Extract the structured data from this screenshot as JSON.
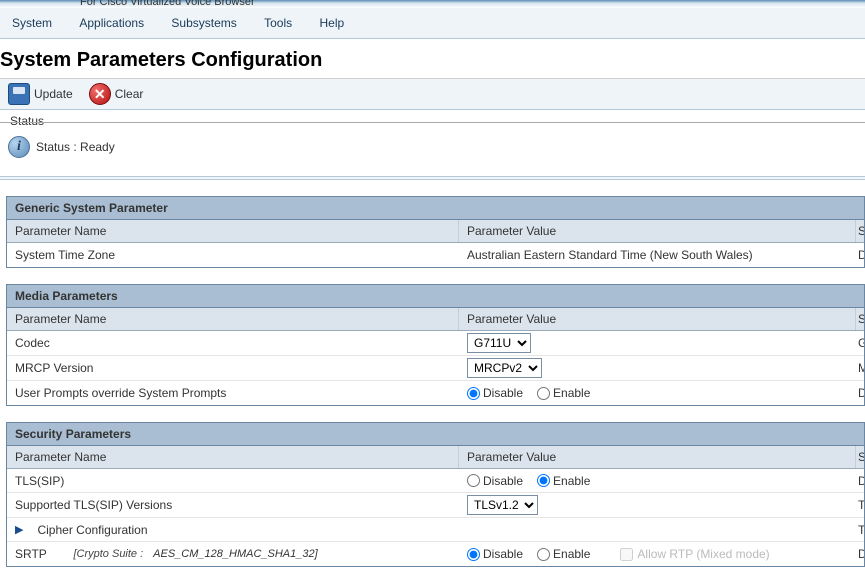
{
  "header": {
    "product_tag": "For Cisco Virtualized Voice Browser"
  },
  "menu": {
    "items": [
      "System",
      "Applications",
      "Subsystems",
      "Tools",
      "Help"
    ]
  },
  "page": {
    "title": "System Parameters Configuration"
  },
  "toolbar": {
    "update_label": "Update",
    "clear_label": "Clear"
  },
  "status": {
    "legend": "Status",
    "text": "Status : Ready"
  },
  "generic_panel": {
    "title": "Generic System Parameter",
    "col_name": "Parameter Name",
    "col_value": "Parameter Value",
    "col_suggested_short": "S",
    "rows": [
      {
        "name": "System Time Zone",
        "value": "Australian Eastern Standard Time (New South Wales)",
        "suggested_short": "D"
      }
    ]
  },
  "media_panel": {
    "title": "Media Parameters",
    "col_name": "Parameter Name",
    "col_value": "Parameter Value",
    "col_suggested_short": "S",
    "codec": {
      "name": "Codec",
      "options": [
        "G711U"
      ],
      "selected": "G711U",
      "suggested_short": "G"
    },
    "mrcp": {
      "name": "MRCP Version",
      "options": [
        "MRCPv2"
      ],
      "selected": "MRCPv2",
      "suggested_short": "M"
    },
    "user_prompts": {
      "name": "User Prompts override System Prompts",
      "disable": "Disable",
      "enable": "Enable",
      "value": "disable",
      "suggested_short": "D"
    }
  },
  "security_panel": {
    "title": "Security Parameters",
    "col_name": "Parameter Name",
    "col_value": "Parameter Value",
    "col_suggested_short": "S",
    "tls_sip": {
      "name": "TLS(SIP)",
      "disable": "Disable",
      "enable": "Enable",
      "value": "enable",
      "suggested_short": "D"
    },
    "tls_versions": {
      "name": "Supported TLS(SIP) Versions",
      "options": [
        "TLSv1.2"
      ],
      "selected": "TLSv1.2",
      "suggested_short": "T"
    },
    "cipher": {
      "name": "Cipher Configuration",
      "suggested_short": "T"
    },
    "srtp": {
      "name": "SRTP",
      "crypto_label": "[Crypto Suite :",
      "crypto_value": "AES_CM_128_HMAC_SHA1_32]",
      "disable": "Disable",
      "enable": "Enable",
      "value": "disable",
      "allow_rtp": "Allow RTP (Mixed mode)",
      "suggested_short": "D"
    }
  }
}
